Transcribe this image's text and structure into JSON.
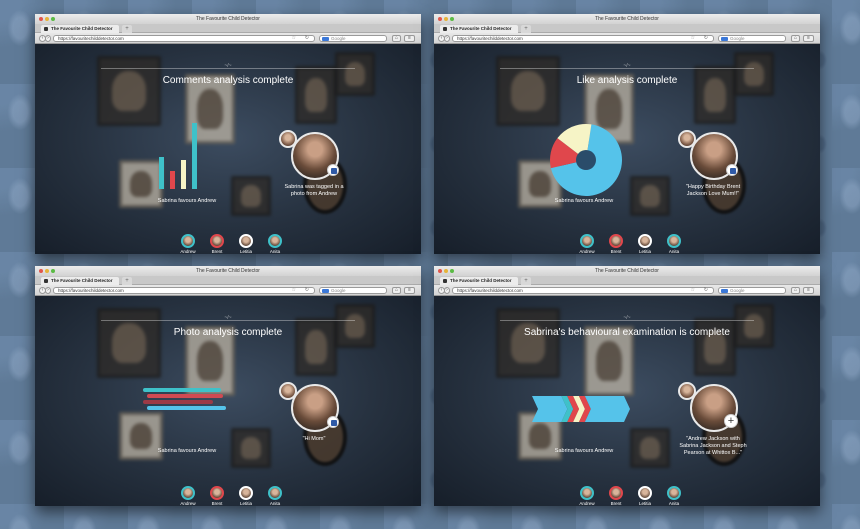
{
  "window_title": "The Favourite Child Detector",
  "tab_label": "The Favourite Child Detector",
  "url": "https://favouritechilddetector.com",
  "search_placeholder": "Google",
  "divider_mark": "~/~",
  "colors": {
    "teal": "#3fc1c9",
    "red": "#e0474c",
    "cream": "#f6f4c6",
    "blue": "#55c3ea",
    "navy": "#1f3a5c"
  },
  "family": [
    {
      "name": "Andrew",
      "ring": "#3fc1c9"
    },
    {
      "name": "Brent",
      "ring": "#e0474c"
    },
    {
      "name": "Letitia",
      "ring": "#ffffff"
    },
    {
      "name": "Anita",
      "ring": "#3fc1c9"
    }
  ],
  "panels": [
    {
      "heading": "Comments analysis complete",
      "favours": "Sabrina favours Andrew",
      "caption_lines": [
        "Sabrina was tagged in a",
        "photo from Andrew"
      ],
      "badge_icon": "facebook-icon"
    },
    {
      "heading": "Like analysis complete",
      "favours": "Sabrina favours Andrew",
      "caption_lines": [
        "\"Happy Birthday Brent",
        "Jackson Love Mum!!\""
      ],
      "badge_icon": "facebook-icon"
    },
    {
      "heading": "Photo analysis complete",
      "favours": "Sabrina favours Andrew",
      "caption_lines": [
        "\"Hi Mom\""
      ],
      "badge_icon": "facebook-icon"
    },
    {
      "heading": "Sabrina's behavioural examination is complete",
      "favours": "Sabrina favours Andrew",
      "caption_lines": [
        "\"Andrew Jackson with",
        "Sabrina Jackson and Steph",
        "Pearson at Whittox B...\""
      ],
      "badge_icon": "plus-icon"
    }
  ],
  "chart_data": [
    {
      "type": "bar",
      "categories": [
        "1",
        "2",
        "3",
        "4"
      ],
      "values": [
        24,
        14,
        22,
        50
      ],
      "colors": [
        "#3fc1c9",
        "#e0474c",
        "#f6f4c6",
        "#3fc1c9"
      ]
    },
    {
      "type": "pie",
      "categories": [
        "blue",
        "red",
        "cream"
      ],
      "values": [
        69,
        14,
        17
      ],
      "colors": [
        "#55c3ea",
        "#e0474c",
        "#f6f4c6"
      ],
      "donut": true
    },
    {
      "type": "bar",
      "orientation": "horizontal",
      "categories": [
        "1",
        "2",
        "3",
        "4"
      ],
      "values": [
        78,
        76,
        70,
        79
      ],
      "colors": [
        "#3fc1c9",
        "#d14a52",
        "#9c3a46",
        "#55c3ea"
      ]
    },
    {
      "type": "bar",
      "orientation": "horizontal",
      "stacked": true,
      "categories": [
        "blue",
        "teal",
        "red",
        "cream",
        "red",
        "blue"
      ],
      "values": [
        30,
        6,
        6,
        6,
        6,
        40
      ],
      "colors": [
        "#55c3ea",
        "#3fc1c9",
        "#e0474c",
        "#f6f4c6",
        "#e0474c",
        "#55c3ea"
      ]
    }
  ]
}
